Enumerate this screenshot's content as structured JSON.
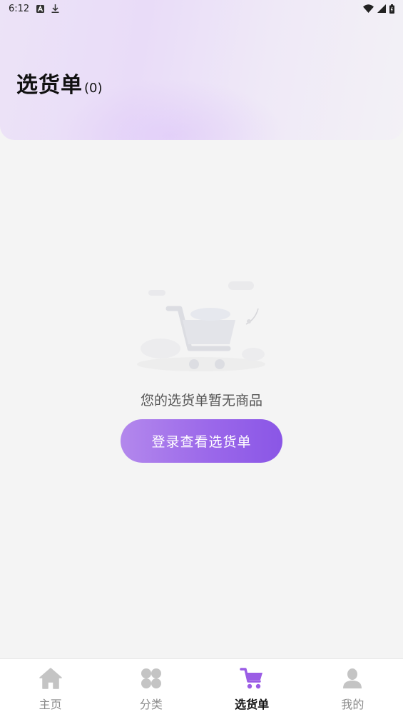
{
  "status_bar": {
    "time": "6:12"
  },
  "header": {
    "title": "选货单",
    "count": "(0)"
  },
  "empty_state": {
    "message": "您的选货单暂无商品",
    "login_button": "登录查看选货单"
  },
  "tab_bar": {
    "active_color": "#9b5de5",
    "inactive_color": "#c4c4c4",
    "items": [
      {
        "label": "主页",
        "icon": "home-icon",
        "active": false
      },
      {
        "label": "分类",
        "icon": "category-icon",
        "active": false
      },
      {
        "label": "选货单",
        "icon": "cart-icon",
        "active": true
      },
      {
        "label": "我的",
        "icon": "profile-icon",
        "active": false
      }
    ]
  }
}
